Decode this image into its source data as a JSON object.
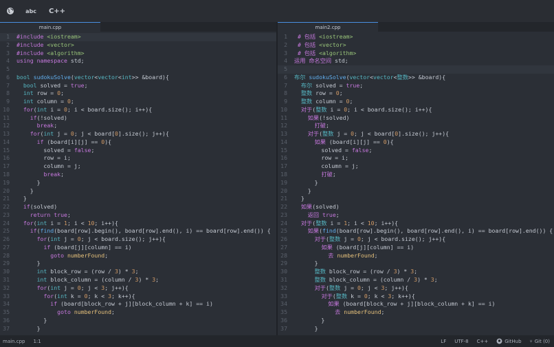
{
  "toolbar": {
    "globe_icon": "globe-icon",
    "abc_label": "abc",
    "cpp_label": "C++"
  },
  "left_pane": {
    "tab": "main.cpp",
    "lines": [
      [
        "1",
        "#include <iostream>"
      ],
      [
        "2",
        "#include <vector>"
      ],
      [
        "3",
        "#include <algorithm>"
      ],
      [
        "4",
        "using namespace std;"
      ],
      [
        "5",
        ""
      ],
      [
        "6",
        "bool sudokuSolve(vector<vector<int>> &board){"
      ],
      [
        "7",
        "  bool solved = true;"
      ],
      [
        "8",
        "  int row = 0;"
      ],
      [
        "9",
        "  int column = 0;"
      ],
      [
        "10",
        "  for(int i = 0; i < board.size(); i++){"
      ],
      [
        "11",
        "    if(!solved)"
      ],
      [
        "12",
        "      break;"
      ],
      [
        "13",
        "    for(int j = 0; j < board[0].size(); j++){"
      ],
      [
        "14",
        "      if (board[i][j] == 0){"
      ],
      [
        "15",
        "        solved = false;"
      ],
      [
        "16",
        "        row = i;"
      ],
      [
        "17",
        "        column = j;"
      ],
      [
        "18",
        "        break;"
      ],
      [
        "19",
        "      }"
      ],
      [
        "20",
        "    }"
      ],
      [
        "21",
        "  }"
      ],
      [
        "22",
        "  if(solved)"
      ],
      [
        "23",
        "    return true;"
      ],
      [
        "24",
        "  for(int i = 1; i < 10; i++){"
      ],
      [
        "25",
        "    if(find(board[row].begin(), board[row].end(), i) == board[row].end()) {"
      ],
      [
        "26",
        "      for(int j = 0; j < board.size(); j++){"
      ],
      [
        "27",
        "        if (board[j][column] == i)"
      ],
      [
        "28",
        "          goto numberFound;"
      ],
      [
        "29",
        "      }"
      ],
      [
        "30",
        "      int block_row = (row / 3) * 3;"
      ],
      [
        "31",
        "      int block_column = (column / 3) * 3;"
      ],
      [
        "32",
        "      for(int j = 0; j < 3; j++){"
      ],
      [
        "33",
        "        for(int k = 0; k < 3; k++){"
      ],
      [
        "34",
        "          if (board[block_row + j][block_column + k] == i)"
      ],
      [
        "35",
        "            goto numberFound;"
      ],
      [
        "36",
        "        }"
      ],
      [
        "37",
        "      }"
      ]
    ]
  },
  "right_pane": {
    "tab": "main2.cpp",
    "lines": [
      [
        "1",
        " # 包括 <iostream>"
      ],
      [
        "2",
        " # 包括 <vector>"
      ],
      [
        "3",
        " # 包括 <algorithm>"
      ],
      [
        "4",
        "运用 命名空间 std;"
      ],
      [
        "5",
        ""
      ],
      [
        "6",
        "布尔 sudokuSolve(vector<vector<整数>> &board){"
      ],
      [
        "7",
        "  布尔 solved = true;"
      ],
      [
        "8",
        "  整数 row = 0;"
      ],
      [
        "9",
        "  整数 column = 0;"
      ],
      [
        "10",
        "  对于(整数 i = 0; i < board.size(); i++){"
      ],
      [
        "11",
        "    如果(!solved)"
      ],
      [
        "12",
        "      打破;"
      ],
      [
        "13",
        "    对于(整数 j = 0; j < board[0].size(); j++){"
      ],
      [
        "14",
        "      如果 (board[i][j] == 0){"
      ],
      [
        "15",
        "        solved = false;"
      ],
      [
        "16",
        "        row = i;"
      ],
      [
        "17",
        "        column = j;"
      ],
      [
        "18",
        "        打破;"
      ],
      [
        "19",
        "      }"
      ],
      [
        "20",
        "    }"
      ],
      [
        "21",
        "  }"
      ],
      [
        "22",
        "  如果(solved)"
      ],
      [
        "23",
        "    返回 true;"
      ],
      [
        "24",
        "  对于(整数 i = 1; i < 10; i++){"
      ],
      [
        "25",
        "    如果(find(board[row].begin(), board[row].end(), i) == board[row].end()) {"
      ],
      [
        "26",
        "      对于(整数 j = 0; j < board.size(); j++){"
      ],
      [
        "27",
        "        如果 (board[j][column] == i)"
      ],
      [
        "28",
        "          去 numberFound;"
      ],
      [
        "29",
        "      }"
      ],
      [
        "30",
        "      整数 block_row = (row / 3) * 3;"
      ],
      [
        "31",
        "      整数 block_column = (column / 3) * 3;"
      ],
      [
        "32",
        "      对于(整数 j = 0; j < 3; j++){"
      ],
      [
        "33",
        "        对于(整数 k = 0; k < 3; k++){"
      ],
      [
        "34",
        "          如果 (board[block_row + j][block_column + k] == i)"
      ],
      [
        "35",
        "            去 numberFound;"
      ],
      [
        "36",
        "        }"
      ],
      [
        "37",
        "      }"
      ]
    ]
  },
  "statusbar": {
    "file": "main.cpp",
    "position": "1:1",
    "line_ending": "LF",
    "encoding": "UTF-8",
    "grammar": "C++",
    "github": "GitHub",
    "git": "Git (0)"
  },
  "colors": {
    "background": "#2b2f36",
    "keyword": "#c678dd",
    "type": "#56b6c2",
    "number": "#d19a66",
    "function": "#61afef",
    "accent": "#4a90e2"
  }
}
